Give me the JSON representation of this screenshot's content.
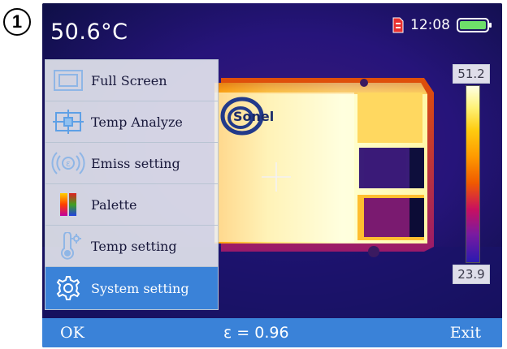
{
  "figure": {
    "step_number": "1"
  },
  "header": {
    "temperature": "50.6°C",
    "time": "12:08",
    "sd_card_icon": "sd-card-icon",
    "battery_icon": "battery-icon"
  },
  "thermal_image": {
    "brand_text": "Sonel"
  },
  "menu": {
    "items": [
      {
        "label": "Full Screen",
        "icon": "full-screen-icon",
        "active": false
      },
      {
        "label": "Temp Analyze",
        "icon": "temp-analyze-icon",
        "active": false
      },
      {
        "label": "Emiss setting",
        "icon": "emissivity-icon",
        "active": false
      },
      {
        "label": "Palette",
        "icon": "palette-icon",
        "active": false
      },
      {
        "label": "Temp setting",
        "icon": "thermometer-icon",
        "active": false
      },
      {
        "label": "System setting",
        "icon": "gear-icon",
        "active": true
      }
    ]
  },
  "scale": {
    "max": "51.2",
    "min": "23.9"
  },
  "footer": {
    "ok_label": "OK",
    "emissivity": "ε = 0.96",
    "exit_label": "Exit"
  },
  "colors": {
    "accent": "#3a82d8",
    "screen_bg": "#0c0c30"
  }
}
